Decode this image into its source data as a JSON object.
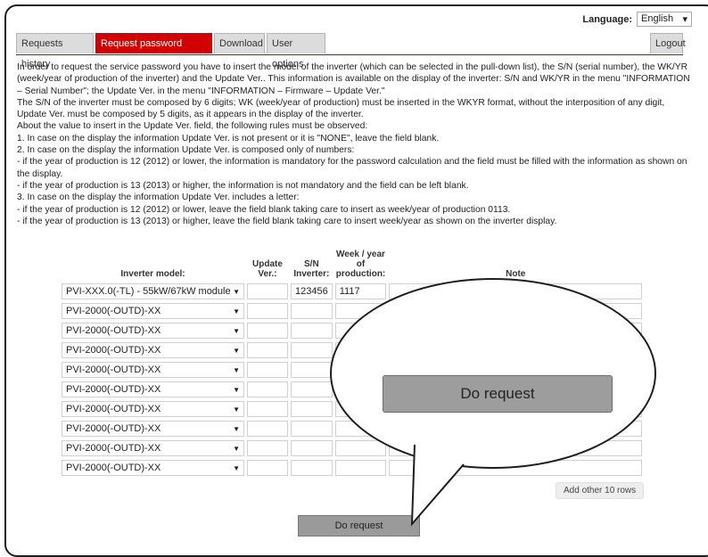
{
  "language": {
    "label": "Language:",
    "value": "English"
  },
  "tabs": [
    {
      "label": "Requests history"
    },
    {
      "label": "Request password Inverter",
      "active": true
    },
    {
      "label": "Download"
    },
    {
      "label": "User options"
    }
  ],
  "logout": "Logout",
  "intro": [
    "In order to request the service password you have to insert the model of the inverter (which can be selected in the pull-down list), the S/N (serial number), the WK/YR (week/year of production of the inverter) and the Update Ver.. This information is available on the display of the inverter: S/N and WK/YR in the menu \"INFORMATION – Serial Number\"; the Update Ver. in the menu \"INFORMATION – Firmware – Update Ver.\"",
    "The S/N of the inverter must be composed by 6 digits; WK (week/year of production) must be inserted in the WKYR format, without the interposition of any digit, Update Ver. must be composed by 5 digits, as it appears in the display of the inverter.",
    "About the value to insert in the Update Ver. field, the following rules must be observed:",
    "1. In case on the display the information Update Ver. is not present or it is \"NONE\", leave the field blank.",
    "2. In case on the display the information Update Ver. is composed only of numbers:",
    "- if the year of production is 12 (2012) or lower, the information is mandatory for the password calculation and the field must be filled with the information as shown on the display.",
    "- if the year of production is 13 (2013) or higher, the information is not mandatory and the field can be left blank.",
    "3. In case on the display the information Update Ver. includes a letter:",
    "- if the year of production is 12 (2012) or lower, leave the field blank taking care to insert as week/year of production 0113.",
    "- if the year of production is 13 (2013) or higher, leave the field blank taking care to insert week/year as shown on the inverter display."
  ],
  "table": {
    "headers": {
      "model": "Inverter model:",
      "update": "Update Ver.:",
      "sn": "S/N Inverter:",
      "week": "Week / year of production:",
      "note": "Note"
    },
    "rows": [
      {
        "model": "PVI-XXX.0(-TL) - 55kW/67kW module",
        "update": "",
        "sn": "123456",
        "week": "1117",
        "note": ""
      },
      {
        "model": "PVI-2000(-OUTD)-XX",
        "update": "",
        "sn": "",
        "week": "",
        "note": ""
      },
      {
        "model": "PVI-2000(-OUTD)-XX",
        "update": "",
        "sn": "",
        "week": "",
        "note": ""
      },
      {
        "model": "PVI-2000(-OUTD)-XX",
        "update": "",
        "sn": "",
        "week": "",
        "note": ""
      },
      {
        "model": "PVI-2000(-OUTD)-XX",
        "update": "",
        "sn": "",
        "week": "",
        "note": ""
      },
      {
        "model": "PVI-2000(-OUTD)-XX",
        "update": "",
        "sn": "",
        "week": "",
        "note": ""
      },
      {
        "model": "PVI-2000(-OUTD)-XX",
        "update": "",
        "sn": "",
        "week": "",
        "note": ""
      },
      {
        "model": "PVI-2000(-OUTD)-XX",
        "update": "",
        "sn": "",
        "week": "",
        "note": ""
      },
      {
        "model": "PVI-2000(-OUTD)-XX",
        "update": "",
        "sn": "",
        "week": "",
        "note": ""
      },
      {
        "model": "PVI-2000(-OUTD)-XX",
        "update": "",
        "sn": "",
        "week": "",
        "note": ""
      }
    ]
  },
  "add_rows": "Add other 10 rows",
  "do_request": "Do request",
  "callout_button": "Do request",
  "colors": {
    "active_tab": "#d20000",
    "button": "#9a9a9a"
  }
}
